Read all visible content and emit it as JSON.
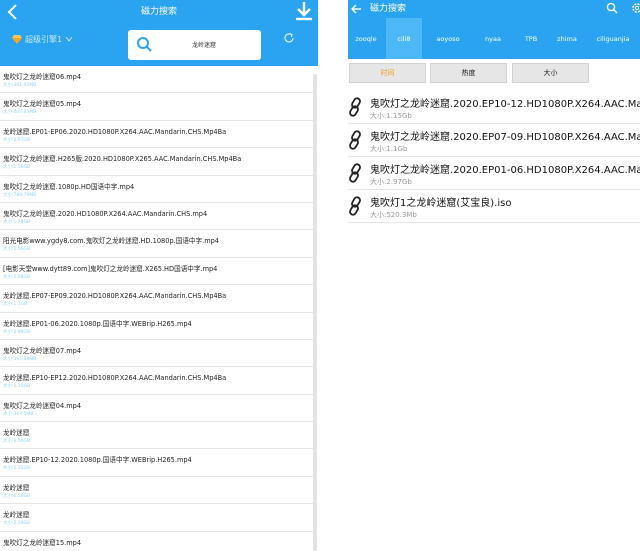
{
  "left": {
    "header": {
      "title": "磁力搜索"
    },
    "engine": {
      "label": "超级引擎1"
    },
    "search": {
      "query": "龙岭迷窟"
    },
    "results": [
      {
        "name": "鬼吹灯之龙岭迷窟06.mp4",
        "size": "大小:361.95MB"
      },
      {
        "name": "鬼吹灯之龙岭迷窟05.mp4",
        "size": "大小:407.83MB"
      },
      {
        "name": "龙岭迷窟.EP01-EP06.2020.HD1080P.X264.AAC.Mandarin.CHS.Mp4Ba",
        "size": "大小:2.97GB"
      },
      {
        "name": "鬼吹灯之龙岭迷窟.H265版.2020.HD1080P.X265.AAC.Mandarin.CHS.Mp4Ba",
        "size": "大小:1.56GB"
      },
      {
        "name": "鬼吹灯之龙岭迷窟.1080p.HD国语中字.mp4",
        "size": "大小:789.79MB"
      },
      {
        "name": "鬼吹灯之龙岭迷窟.2020.HD1080P.X264.AAC.Mandarin.CHS.mp4",
        "size": "大小:1.28GB"
      },
      {
        "name": "阳光电影www.ygdy8.com.鬼吹灯之龙岭迷窟.HD.1080p.国语中字.mp4",
        "size": "大小:1.56GB"
      },
      {
        "name": "[电影天堂www.dytt89.com]鬼吹灯之龙岭迷窟.X265.HD国语中字.mp4",
        "size": "大小:1.58GB"
      },
      {
        "name": "龙岭迷窟.EP07-EP09.2020.HD1080P.X264.AAC.Mandarin.CHS.Mp4Ba",
        "size": "大小:1.1GB"
      },
      {
        "name": "龙岭迷窟.EP01-06.2020.1080p.国语中字.WEBrip.H265.mp4",
        "size": "大小:2.89GB"
      },
      {
        "name": "鬼吹灯之龙岭迷窟07.mp4",
        "size": "大小:361.98MB"
      },
      {
        "name": "龙岭迷窟.EP10-EP12.2020.HD1080P.X264.AAC.Mandarin.CHS.Mp4Ba",
        "size": "大小:1.15GB"
      },
      {
        "name": "鬼吹灯之龙岭迷窟04.mp4",
        "size": "大小:363.5MB"
      },
      {
        "name": "龙岭迷窟",
        "size": "大小:6.56GB"
      },
      {
        "name": "龙岭迷窟.EP10-12.2020.1080p.国语中字.WEBrip.H265.mp4",
        "size": "大小:1.35GB"
      },
      {
        "name": "龙岭迷窟",
        "size": "大小:6.56GB"
      },
      {
        "name": "龙岭迷窟",
        "size": "大小:2.29GB"
      },
      {
        "name": "鬼吹灯之龙岭迷窟15.mp4",
        "size": ""
      }
    ]
  },
  "right": {
    "header": {
      "title": "磁力搜索"
    },
    "tabs": [
      {
        "label": "zooqle",
        "active": false
      },
      {
        "label": "cili8",
        "active": true
      },
      {
        "label": "aoyoso",
        "active": false
      },
      {
        "label": "nyaa",
        "active": false
      },
      {
        "label": "TPB",
        "active": false
      },
      {
        "label": "zhima",
        "active": false
      },
      {
        "label": "ciliguanjia",
        "active": false
      }
    ],
    "sort": [
      {
        "label": "时间",
        "active": true
      },
      {
        "label": "热度",
        "active": false
      },
      {
        "label": "大小",
        "active": false
      }
    ],
    "results": [
      {
        "name": "鬼吹灯之龙岭迷窟.2020.EP10-12.HD1080P.X264.AAC.Mandarin.C",
        "size": "大小:1.15Gb"
      },
      {
        "name": "鬼吹灯之龙岭迷窟.2020.EP07-09.HD1080P.X264.AAC.Mandarin.C",
        "size": "大小:1.1Gb"
      },
      {
        "name": "鬼吹灯之龙岭迷窟.2020.EP01-06.HD1080P.X264.AAC.Mandarin.C",
        "size": "大小:2.97Gb"
      },
      {
        "name": "鬼吹灯1之龙岭迷窟(艾宝良).iso",
        "size": "大小:520.3Mb"
      }
    ]
  },
  "colors": {
    "accent": "#2aa3f0",
    "active_tab": "#4cb8f6",
    "active_sort": "#f39a1e",
    "size_text": "#8fd4ff"
  }
}
